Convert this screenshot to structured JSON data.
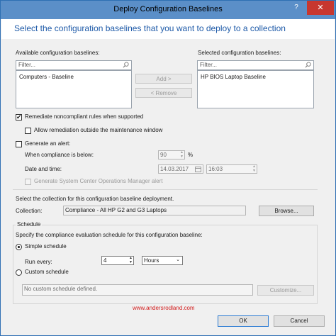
{
  "window": {
    "title": "Deploy Configuration Baselines",
    "help_glyph": "?",
    "close_glyph": "✕"
  },
  "instruction": "Select the configuration baselines that you want to deploy to a collection",
  "available": {
    "label": "Available configuration baselines:",
    "filter_placeholder": "Filter...",
    "items": [
      "Computers - Baseline"
    ]
  },
  "selected": {
    "label": "Selected configuration baselines:",
    "filter_placeholder": "Filter...",
    "items": [
      "HP BIOS Laptop Baseline"
    ]
  },
  "buttons": {
    "add": "Add >",
    "remove": "< Remove",
    "browse": "Browse...",
    "customize": "Customize...",
    "ok": "OK",
    "cancel": "Cancel"
  },
  "options": {
    "remediate": {
      "label": "Remediate noncompliant rules when supported",
      "checked": true
    },
    "allow_outside": {
      "label": "Allow remediation outside the maintenance window",
      "checked": false
    },
    "generate_alert": {
      "label": "Generate an alert:",
      "checked": false
    }
  },
  "alert": {
    "compliance_label": "When compliance is below:",
    "compliance_value": "90",
    "percent": "%",
    "datetime_label": "Date and time:",
    "date_value": "14.03.2017",
    "time_value": "16:03",
    "scom_label": "Generate System Center Operations Manager alert"
  },
  "collection": {
    "instruction": "Select the collection for this configuration baseline deployment.",
    "label": "Collection:",
    "value": "Compliance - All HP G2 and G3 Laptops"
  },
  "schedule": {
    "group_title": "Schedule",
    "instruction": "Specify the compliance evaluation schedule for this configuration baseline:",
    "simple_label": "Simple schedule",
    "run_every_label": "Run every:",
    "run_every_value": "4",
    "unit_value": "Hours",
    "custom_label": "Custom schedule",
    "custom_text": "No custom schedule defined.",
    "selected_mode": "simple"
  },
  "watermark": "www.andersrodland.com",
  "colors": {
    "accent": "#1e5aa8",
    "titlebar": "#5b8fc8",
    "close": "#c7372f",
    "watermark": "#d21b1b"
  }
}
